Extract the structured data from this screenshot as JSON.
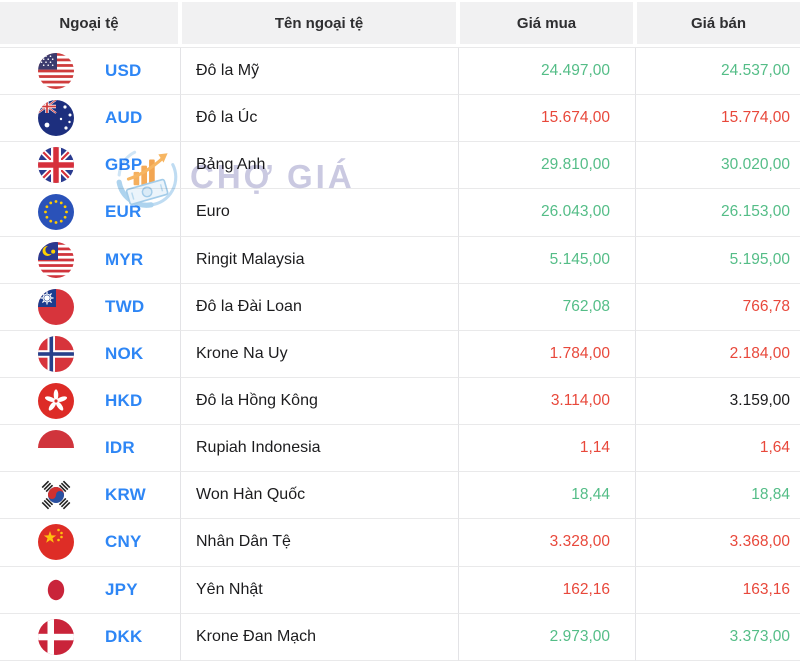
{
  "header": {
    "cols": [
      "Ngoại tệ",
      "Tên ngoại tệ",
      "Giá mua",
      "Giá bán"
    ]
  },
  "watermark": {
    "text": "CHỢ GIÁ",
    "logo": "chart-money-logo"
  },
  "colors": {
    "up": "#54bd87",
    "down": "#e8483b",
    "neutral": "#1c1c1e",
    "code_link": "#2e86f5",
    "header_bg": "#f1f1f2"
  },
  "rows": [
    {
      "flag": "us",
      "code": "USD",
      "name": "Đô la Mỹ",
      "buy": "24.497,00",
      "sell": "24.537,00",
      "buy_trend": "up",
      "sell_trend": "up"
    },
    {
      "flag": "au",
      "code": "AUD",
      "name": "Đô la Úc",
      "buy": "15.674,00",
      "sell": "15.774,00",
      "buy_trend": "down",
      "sell_trend": "down"
    },
    {
      "flag": "gb",
      "code": "GBP",
      "name": "Bảng Anh",
      "buy": "29.810,00",
      "sell": "30.020,00",
      "buy_trend": "up",
      "sell_trend": "up"
    },
    {
      "flag": "eu",
      "code": "EUR",
      "name": "Euro",
      "buy": "26.043,00",
      "sell": "26.153,00",
      "buy_trend": "up",
      "sell_trend": "up"
    },
    {
      "flag": "my",
      "code": "MYR",
      "name": "Ringit Malaysia",
      "buy": "5.145,00",
      "sell": "5.195,00",
      "buy_trend": "up",
      "sell_trend": "up"
    },
    {
      "flag": "tw",
      "code": "TWD",
      "name": "Đô la Đài Loan",
      "buy": "762,08",
      "sell": "766,78",
      "buy_trend": "up",
      "sell_trend": "down"
    },
    {
      "flag": "no",
      "code": "NOK",
      "name": "Krone Na Uy",
      "buy": "1.784,00",
      "sell": "2.184,00",
      "buy_trend": "down",
      "sell_trend": "down"
    },
    {
      "flag": "hk",
      "code": "HKD",
      "name": "Đô la Hồng Kông",
      "buy": "3.114,00",
      "sell": "3.159,00",
      "buy_trend": "down",
      "sell_trend": "flat"
    },
    {
      "flag": "id",
      "code": "IDR",
      "name": "Rupiah Indonesia",
      "buy": "1,14",
      "sell": "1,64",
      "buy_trend": "down",
      "sell_trend": "down"
    },
    {
      "flag": "kr",
      "code": "KRW",
      "name": "Won Hàn Quốc",
      "buy": "18,44",
      "sell": "18,84",
      "buy_trend": "up",
      "sell_trend": "up"
    },
    {
      "flag": "cn",
      "code": "CNY",
      "name": "Nhân Dân Tệ",
      "buy": "3.328,00",
      "sell": "3.368,00",
      "buy_trend": "down",
      "sell_trend": "down"
    },
    {
      "flag": "jp",
      "code": "JPY",
      "name": "Yên Nhật",
      "buy": "162,16",
      "sell": "163,16",
      "buy_trend": "down",
      "sell_trend": "down"
    },
    {
      "flag": "dk",
      "code": "DKK",
      "name": "Krone Đan Mạch",
      "buy": "2.973,00",
      "sell": "3.373,00",
      "buy_trend": "up",
      "sell_trend": "up"
    }
  ]
}
